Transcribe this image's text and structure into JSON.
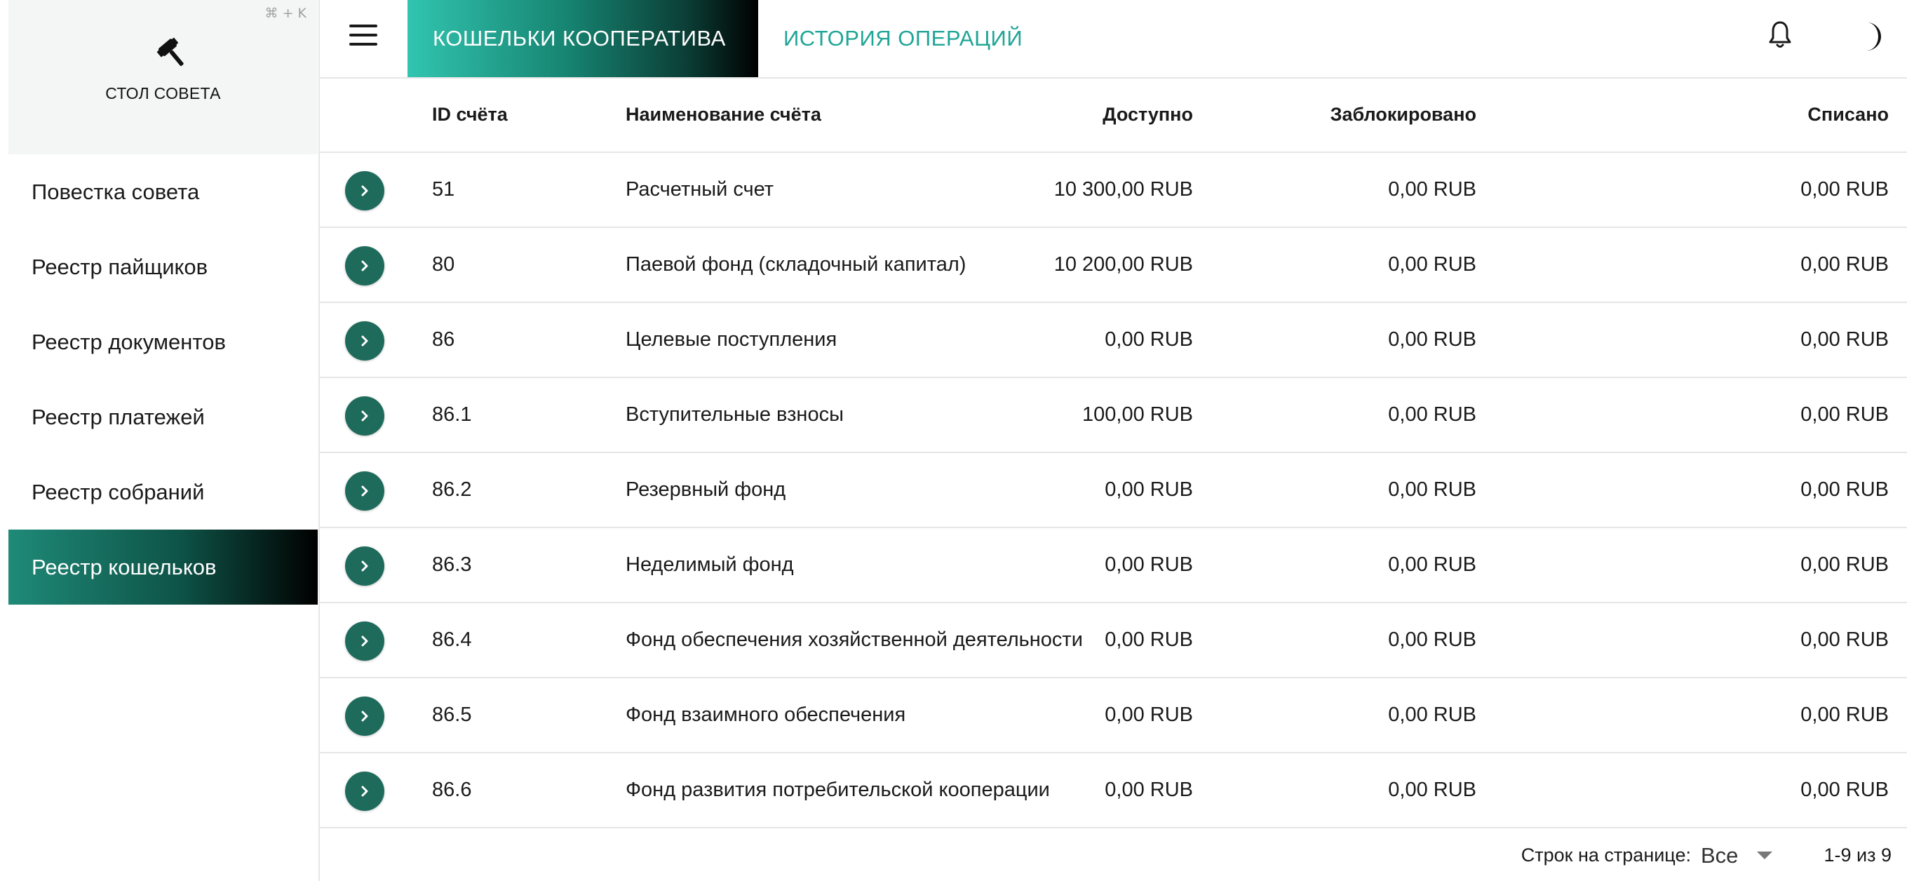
{
  "sidebar": {
    "shortcut": "⌘ + K",
    "brand_icon": "gavel-icon",
    "title": "СТОЛ СОВЕТА",
    "items": [
      {
        "label": "Повестка совета"
      },
      {
        "label": "Реестр пайщиков"
      },
      {
        "label": "Реестр документов"
      },
      {
        "label": "Реестр платежей"
      },
      {
        "label": "Реестр собраний"
      },
      {
        "label": "Реестр кошельков",
        "active": true
      }
    ]
  },
  "header": {
    "menu_icon": "hamburger-menu-icon",
    "tabs": [
      {
        "label": "КОШЕЛЬКИ КООПЕРАТИВА",
        "active": true
      },
      {
        "label": "ИСТОРИЯ ОПЕРАЦИЙ",
        "active": false
      }
    ],
    "notification_icon": "bell-icon",
    "theme_icon": "moon-icon"
  },
  "table": {
    "columns": {
      "id": "ID счёта",
      "name": "Наименование счёта",
      "available": "Доступно",
      "blocked": "Заблокировано",
      "spent": "Списано"
    },
    "rows": [
      {
        "id": "51",
        "name": "Расчетный счет",
        "available": "10 300,00 RUB",
        "blocked": "0,00 RUB",
        "spent": "0,00 RUB"
      },
      {
        "id": "80",
        "name": "Паевой фонд (складочный капитал)",
        "available": "10 200,00 RUB",
        "blocked": "0,00 RUB",
        "spent": "0,00 RUB"
      },
      {
        "id": "86",
        "name": "Целевые поступления",
        "available": "0,00 RUB",
        "blocked": "0,00 RUB",
        "spent": "0,00 RUB"
      },
      {
        "id": "86.1",
        "name": "Вступительные взносы",
        "available": "100,00 RUB",
        "blocked": "0,00 RUB",
        "spent": "0,00 RUB"
      },
      {
        "id": "86.2",
        "name": "Резервный фонд",
        "available": "0,00 RUB",
        "blocked": "0,00 RUB",
        "spent": "0,00 RUB"
      },
      {
        "id": "86.3",
        "name": "Неделимый фонд",
        "available": "0,00 RUB",
        "blocked": "0,00 RUB",
        "spent": "0,00 RUB"
      },
      {
        "id": "86.4",
        "name": "Фонд обеспечения хозяйственной деятельности",
        "available": "0,00 RUB",
        "blocked": "0,00 RUB",
        "spent": "0,00 RUB"
      },
      {
        "id": "86.5",
        "name": "Фонд взаимного обеспечения",
        "available": "0,00 RUB",
        "blocked": "0,00 RUB",
        "spent": "0,00 RUB"
      },
      {
        "id": "86.6",
        "name": "Фонд развития потребительской кооперации",
        "available": "0,00 RUB",
        "blocked": "0,00 RUB",
        "spent": "0,00 RUB"
      }
    ]
  },
  "pagination": {
    "rows_per_page_label": "Строк на странице:",
    "rows_per_page_value": "Все",
    "range": "1-9 из 9"
  },
  "colors": {
    "accent": "#1fa596",
    "button": "#1e6b5c",
    "active_gradient_start": "#1f8a78"
  }
}
